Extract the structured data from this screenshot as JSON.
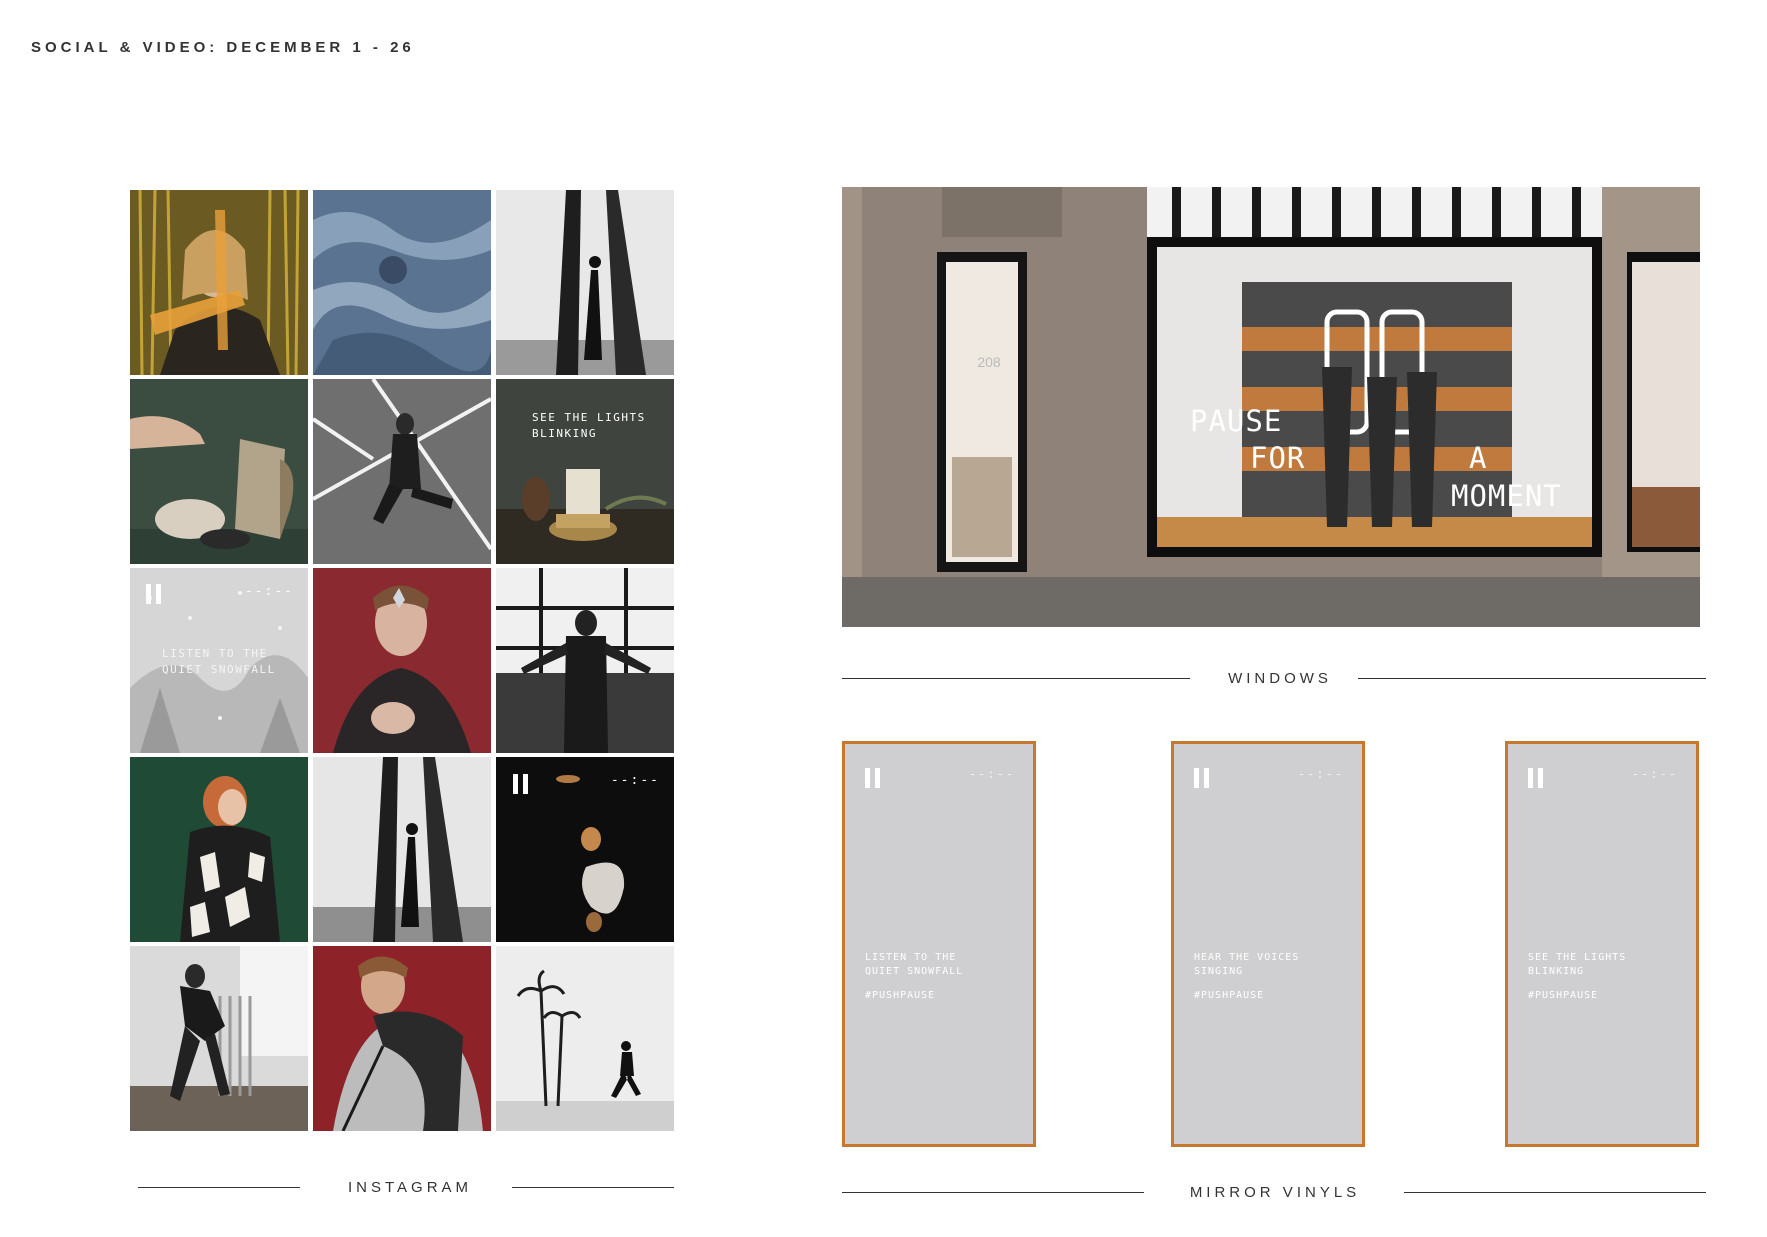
{
  "header": {
    "title": "SOCIAL & VIDEO: DECEMBER 1 - 26"
  },
  "instagram": {
    "label": "INSTAGRAM",
    "overlays": {
      "lights": "SEE THE LIGHTS\nBLINKING",
      "snowfall": "LISTEN TO THE\nQUIET SNOWFALL",
      "timer": "--:--"
    }
  },
  "windows": {
    "label": "WINDOWS",
    "door_number": "208",
    "words": [
      "PAUSE",
      "FOR",
      "A",
      "MOMENT"
    ]
  },
  "mirror_vinyls": {
    "label": "MIRROR VINYLS",
    "items": [
      {
        "text": "LISTEN TO THE\nQUIET SNOWFALL",
        "tag": "#PUSHPAUSE",
        "timer": "--:--"
      },
      {
        "text": "HEAR THE VOICES\nSINGING",
        "tag": "#PUSHPAUSE",
        "timer": "--:--"
      },
      {
        "text": "SEE THE LIGHTS\nBLINKING",
        "tag": "#PUSHPAUSE",
        "timer": "--:--"
      }
    ]
  },
  "colors": {
    "accent": "#c8772e",
    "mirror_fill": "#cfcfd1"
  }
}
